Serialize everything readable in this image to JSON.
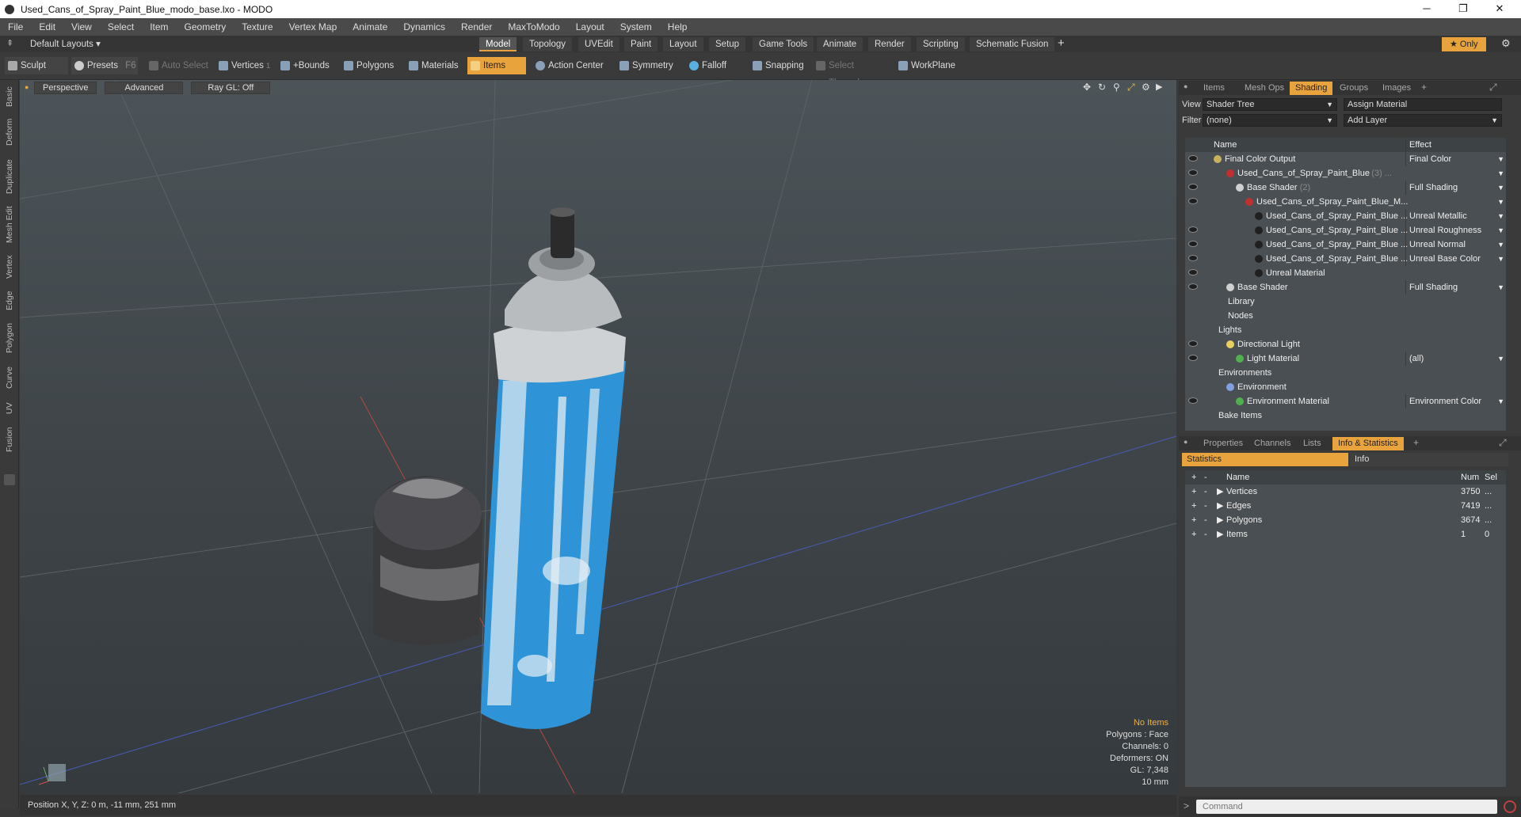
{
  "window": {
    "title": "Used_Cans_of_Spray_Paint_Blue_modo_base.lxo - MODO"
  },
  "menu": [
    "File",
    "Edit",
    "View",
    "Select",
    "Item",
    "Geometry",
    "Texture",
    "Vertex Map",
    "Animate",
    "Dynamics",
    "Render",
    "MaxToModo",
    "Layout",
    "System",
    "Help"
  ],
  "layout": {
    "preset": "Default Layouts ▾",
    "tabs": [
      "Model",
      "Topology",
      "UVEdit",
      "Paint",
      "Layout",
      "Setup",
      "Game Tools",
      "Animate",
      "Render",
      "Scripting",
      "Schematic Fusion"
    ],
    "active_tab": "Model",
    "add": "+",
    "only": "★ Only"
  },
  "toolbar": {
    "sculpt": "Sculpt",
    "presets": "Presets",
    "presets_key": "F6",
    "auto_select": "Auto Select",
    "vertices": "Vertices",
    "vertices_count": "1",
    "bounds": "+Bounds",
    "polygons": "Polygons",
    "materials": "Materials",
    "items": "Items",
    "action_center": "Action Center",
    "symmetry": "Symmetry",
    "falloff": "Falloff",
    "snapping": "Snapping",
    "select_through": "Select Through",
    "workplane": "WorkPlane"
  },
  "left_tabs": [
    "Basic",
    "Deform",
    "Duplicate",
    "Mesh Edit",
    "Vertex",
    "Edge",
    "Polygon",
    "Curve",
    "UV",
    "Fusion"
  ],
  "viewport": {
    "view": "Perspective",
    "mode": "Advanced",
    "raygl": "Ray GL: Off",
    "info": {
      "no_items": "No Items",
      "polygons": "Polygons : Face",
      "channels": "Channels: 0",
      "deformers": "Deformers: ON",
      "gl": "GL: 7,348",
      "scale": "10 mm"
    }
  },
  "status": {
    "position": "Position X, Y, Z:  0 m, -11 mm, 251 mm"
  },
  "shader_panel": {
    "tabs": [
      "Items",
      "Mesh Ops",
      "Shading",
      "Groups",
      "Images"
    ],
    "active_tab": "Shading",
    "view_label": "View",
    "view_value": "Shader Tree",
    "assign_material": "Assign Material",
    "filter_label": "Filter",
    "filter_value": "(none)",
    "add_layer": "Add Layer",
    "col_name": "Name",
    "col_effect": "Effect",
    "rows": [
      {
        "name": "Final Color Output",
        "effect": "Final Color",
        "indent": 50,
        "eye": true,
        "dot": "#c8b060",
        "dd": true
      },
      {
        "name": "Used_Cans_of_Spray_Paint_Blue",
        "suffix": "(3) ...",
        "effect": "",
        "indent": 66,
        "eye": true,
        "dot": "#c03030",
        "dd": true
      },
      {
        "name": "Base Shader",
        "suffix": "(2)",
        "effect": "Full Shading",
        "indent": 78,
        "eye": true,
        "dot": "#d0d0d0",
        "dd": true
      },
      {
        "name": "Used_Cans_of_Spray_Paint_Blue_M...",
        "effect": "",
        "indent": 90,
        "eye": true,
        "dot": "#c03030",
        "dd": true
      },
      {
        "name": "Used_Cans_of_Spray_Paint_Blue ...",
        "effect": "Unreal Metallic",
        "indent": 102,
        "eye": false,
        "dot": "#202020",
        "dd": true
      },
      {
        "name": "Used_Cans_of_Spray_Paint_Blue ...",
        "effect": "Unreal Roughness",
        "indent": 102,
        "eye": true,
        "dot": "#202020",
        "dd": true
      },
      {
        "name": "Used_Cans_of_Spray_Paint_Blue ...",
        "effect": "Unreal Normal",
        "indent": 102,
        "eye": true,
        "dot": "#202020",
        "dd": true
      },
      {
        "name": "Used_Cans_of_Spray_Paint_Blue ...",
        "effect": "Unreal Base Color",
        "indent": 102,
        "eye": true,
        "dot": "#202020",
        "dd": true
      },
      {
        "name": "Unreal Material",
        "effect": "",
        "indent": 102,
        "eye": true,
        "dot": "#202020",
        "dd": false
      },
      {
        "name": "Base Shader",
        "effect": "Full Shading",
        "indent": 66,
        "eye": true,
        "dot": "#d0d0d0",
        "dd": true
      },
      {
        "name": "Library",
        "effect": "",
        "indent": 54,
        "eye": false,
        "dot": "",
        "dd": false
      },
      {
        "name": "Nodes",
        "effect": "",
        "indent": 54,
        "eye": false,
        "dot": "",
        "dd": false
      },
      {
        "name": "Lights",
        "effect": "",
        "indent": 42,
        "eye": false,
        "dot": "",
        "dd": false
      },
      {
        "name": "Directional Light",
        "effect": "",
        "indent": 66,
        "eye": true,
        "dot": "#e8d060",
        "dd": false
      },
      {
        "name": "Light Material",
        "effect": "(all)",
        "indent": 78,
        "eye": true,
        "dot": "#50b050",
        "dd": true
      },
      {
        "name": "Environments",
        "effect": "",
        "indent": 42,
        "eye": false,
        "dot": "",
        "dd": false
      },
      {
        "name": "Environment",
        "effect": "",
        "indent": 66,
        "eye": false,
        "dot": "#80a0e0",
        "dd": false
      },
      {
        "name": "Environment Material",
        "effect": "Environment Color",
        "indent": 78,
        "eye": true,
        "dot": "#50b050",
        "dd": true
      },
      {
        "name": "Bake Items",
        "effect": "",
        "indent": 42,
        "eye": false,
        "dot": "",
        "dd": false
      }
    ]
  },
  "stats_panel": {
    "tabs": [
      "Properties",
      "Channels",
      "Lists",
      "Info & Statistics"
    ],
    "active_tab": "Info & Statistics",
    "sub_statistics": "Statistics",
    "sub_info": "Info",
    "col_name": "Name",
    "col_num": "Num",
    "col_sel": "Sel",
    "rows": [
      {
        "name": "Vertices",
        "num": "3750",
        "sel": "..."
      },
      {
        "name": "Edges",
        "num": "7419",
        "sel": "..."
      },
      {
        "name": "Polygons",
        "num": "3674",
        "sel": "..."
      },
      {
        "name": "Items",
        "num": "1",
        "sel": "0"
      }
    ]
  },
  "command": {
    "placeholder": "Command"
  },
  "colors": {
    "accent": "#e8a33d",
    "can_blue": "#2f93d8"
  }
}
